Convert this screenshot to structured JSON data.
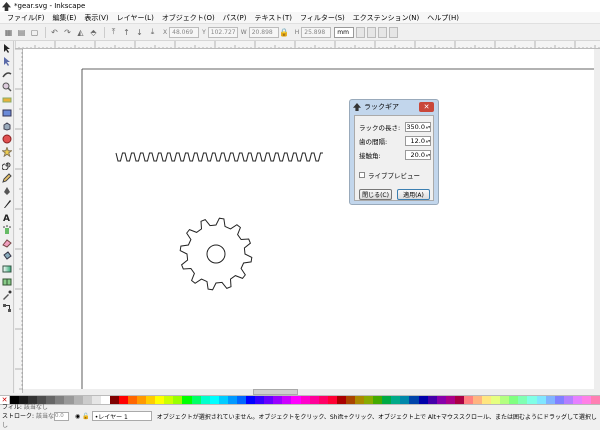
{
  "window": {
    "title": "*gear.svg - Inkscape"
  },
  "menubar": {
    "items": [
      "ファイル(F)",
      "編集(E)",
      "表示(V)",
      "レイヤー(L)",
      "オブジェクト(O)",
      "パス(P)",
      "テキスト(T)",
      "フィルター(S)",
      "エクステンション(N)",
      "ヘルプ(H)"
    ]
  },
  "toolctrl": {
    "x_label": "X",
    "x_value": "48.069",
    "y_label": "Y",
    "y_value": "102.727",
    "w_label": "W",
    "w_value": "20.898",
    "h_label": "H",
    "h_value": "25.898",
    "unit": "mm"
  },
  "dialog": {
    "title": "ラックギア",
    "fields": [
      {
        "label": "ラックの長さ:",
        "value": "350.0"
      },
      {
        "label": "歯の間隔:",
        "value": "12.0"
      },
      {
        "label": "接触角:",
        "value": "20.0"
      }
    ],
    "live_preview_label": "ライブプレビュー",
    "close_label": "閉じる(C)",
    "apply_label": "適用(A)"
  },
  "statusbar": {
    "fill_label": "フィル:",
    "fill_value": "該当なし",
    "stroke_label": "ストローク:",
    "stroke_value": "該当なし",
    "opacity": "0.0",
    "layer": "•レイヤー 1",
    "message": "オブジェクトが選択されていません。オブジェクトをクリック、Shift+クリック、オブジェクト上で Alt+マウススクロール、または囲むようにドラッグして選択し"
  },
  "colors": {
    "palette": [
      "#000000",
      "#1a1a1a",
      "#333333",
      "#4d4d4d",
      "#666666",
      "#808080",
      "#999999",
      "#b3b3b3",
      "#cccccc",
      "#e6e6e6",
      "#ffffff",
      "#800000",
      "#ff0000",
      "#ff6600",
      "#ff9900",
      "#ffcc00",
      "#ffff00",
      "#ccff00",
      "#99ff00",
      "#00ff00",
      "#00ff66",
      "#00ffcc",
      "#00ffff",
      "#00ccff",
      "#0099ff",
      "#0066ff",
      "#0000ff",
      "#3300ff",
      "#6600ff",
      "#9900ff",
      "#cc00ff",
      "#ff00ff",
      "#ff00cc",
      "#ff0099",
      "#ff0066",
      "#ff0033",
      "#aa0000",
      "#aa4400",
      "#aa8800",
      "#88aa00",
      "#44aa00",
      "#00aa44",
      "#00aa88",
      "#0088aa",
      "#0044aa",
      "#0000aa",
      "#4400aa",
      "#8800aa",
      "#aa0088",
      "#aa0044",
      "#ff8080",
      "#ffb380",
      "#ffe680",
      "#e6ff80",
      "#b3ff80",
      "#80ff80",
      "#80ffb3",
      "#80ffe6",
      "#80e6ff",
      "#80b3ff",
      "#8080ff",
      "#b380ff",
      "#e680ff",
      "#ff80e6",
      "#ff80b3"
    ]
  },
  "toolbox_icons": [
    "select-tool-icon",
    "node-tool-icon",
    "tweak-tool-icon",
    "zoom-tool-icon",
    "measure-tool-icon",
    "rect-tool-icon",
    "box3d-tool-icon",
    "ellipse-tool-icon",
    "star-tool-icon",
    "spiral-tool-icon",
    "pencil-tool-icon",
    "pen-tool-icon",
    "calligraphy-tool-icon",
    "text-tool-icon",
    "spray-tool-icon",
    "eraser-tool-icon",
    "bucket-tool-icon",
    "gradient-tool-icon",
    "mesh-tool-icon",
    "dropper-tool-icon",
    "connector-tool-icon"
  ]
}
